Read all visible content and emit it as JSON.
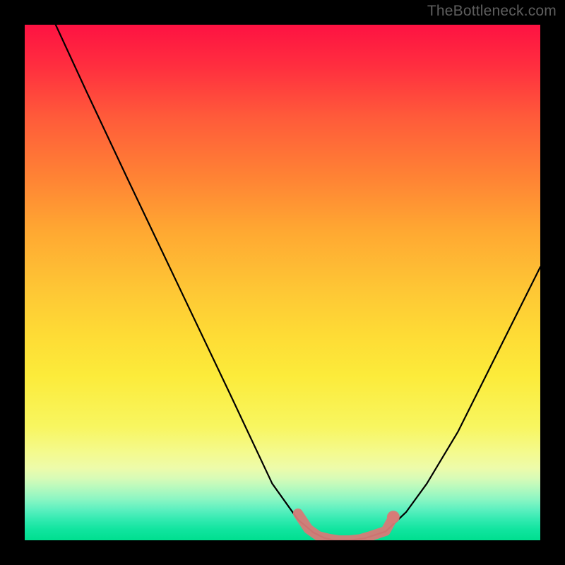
{
  "watermark": "TheBottleneck.com",
  "chart_data": {
    "type": "line",
    "title": "",
    "xlabel": "",
    "ylabel": "",
    "xlim": [
      0,
      100
    ],
    "ylim": [
      0,
      100
    ],
    "series": [
      {
        "name": "bottleneck-curve",
        "color": "#000000",
        "x": [
          6,
          12,
          20,
          30,
          40,
          48,
          53,
          56,
          58,
          60,
          63,
          66,
          70,
          74,
          78,
          84,
          90,
          96,
          100
        ],
        "y": [
          100,
          87,
          70,
          49,
          28,
          11,
          4,
          1.5,
          0.5,
          0,
          0,
          0.4,
          1.7,
          5.5,
          11,
          21,
          33,
          45,
          53
        ]
      },
      {
        "name": "highlight-band",
        "color": "#d77a77",
        "x": [
          53,
          55,
          57,
          59,
          61,
          63,
          65,
          67,
          70,
          71.5
        ],
        "y": [
          5.2,
          2.2,
          0.8,
          0.3,
          0,
          0,
          0.2,
          0.8,
          1.8,
          4.5
        ]
      }
    ],
    "markers": [
      {
        "name": "highlight-dot",
        "x": 71.5,
        "y": 4.5,
        "color": "#d77a77"
      }
    ],
    "background_gradient": {
      "orientation": "vertical",
      "stops": [
        {
          "pos": 0.0,
          "color": "#fe1242"
        },
        {
          "pos": 0.3,
          "color": "#ff8434"
        },
        {
          "pos": 0.6,
          "color": "#fedb35"
        },
        {
          "pos": 0.83,
          "color": "#f4fa8e"
        },
        {
          "pos": 1.0,
          "color": "#00df8f"
        }
      ]
    }
  }
}
